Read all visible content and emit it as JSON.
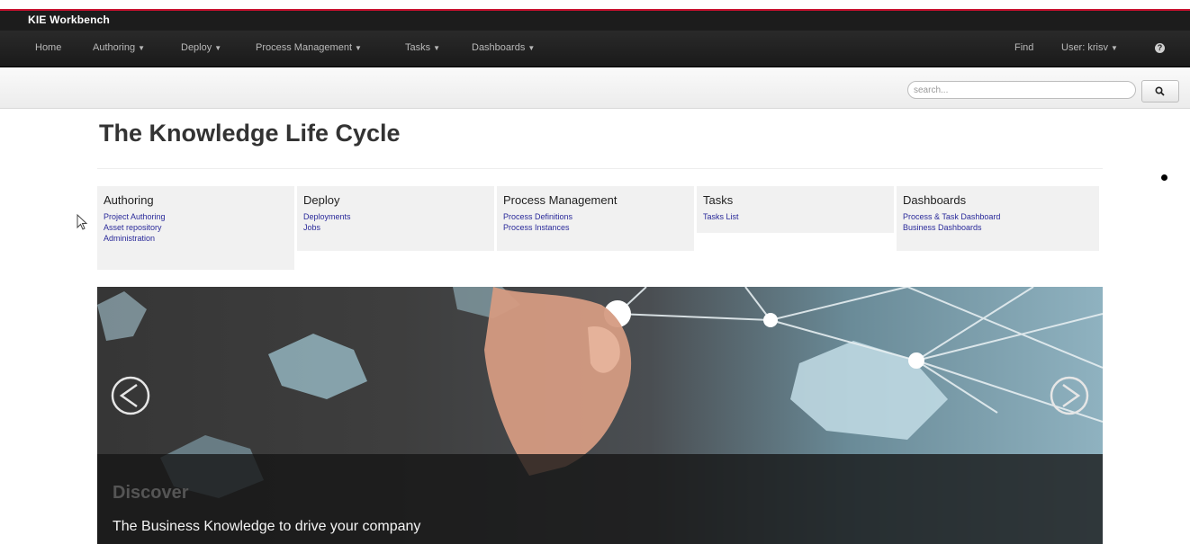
{
  "app": {
    "title": "KIE Workbench"
  },
  "nav": {
    "items": [
      {
        "label": "Home",
        "caret": ""
      },
      {
        "label": "Authoring",
        "caret": "▼"
      },
      {
        "label": "Deploy",
        "caret": "▼"
      },
      {
        "label": "Process Management",
        "caret": "▼"
      },
      {
        "label": "Tasks",
        "caret": "▼"
      },
      {
        "label": "Dashboards",
        "caret": "▼"
      }
    ],
    "find": "Find",
    "user": "User: krisv",
    "help": "?"
  },
  "search": {
    "placeholder": "search..."
  },
  "page": {
    "title": "The Knowledge Life Cycle"
  },
  "categories": [
    {
      "heading": "Authoring",
      "links": [
        "Project Authoring",
        "Asset repository",
        "Administration"
      ]
    },
    {
      "heading": "Deploy",
      "links": [
        "Deployments",
        "Jobs"
      ]
    },
    {
      "heading": "Process Management",
      "links": [
        "Process Definitions",
        "Process Instances"
      ]
    },
    {
      "heading": "Tasks",
      "links": [
        "Tasks List"
      ]
    },
    {
      "heading": "Dashboards",
      "links": [
        "Process & Task Dashboard",
        "Business Dashboards"
      ]
    }
  ],
  "carousel": {
    "caption_title": "Discover",
    "caption_text": "The Business Knowledge to drive your company"
  },
  "colors": {
    "accent_red": "#c8102e",
    "navbar": "#1c1c1c",
    "link": "#2a2a9a"
  }
}
